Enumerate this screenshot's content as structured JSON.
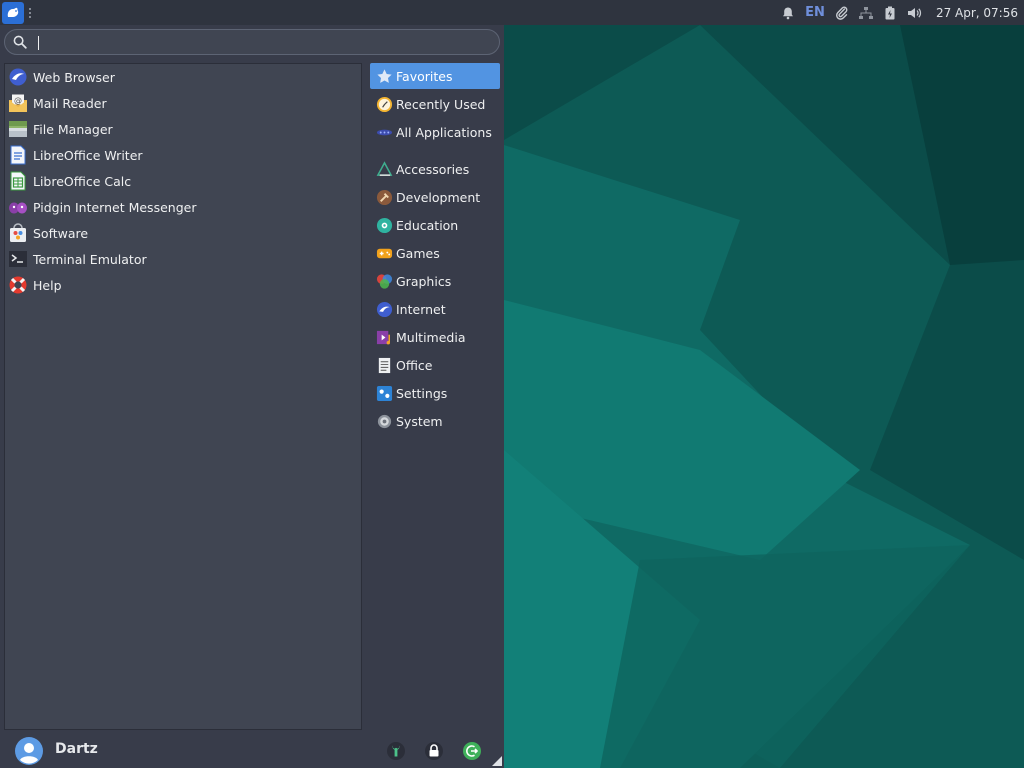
{
  "panel": {
    "keyboard_layout": "EN",
    "clock": "27 Apr, 07:56"
  },
  "search": {
    "value": "",
    "placeholder": ""
  },
  "favorites": [
    {
      "label": "Web Browser",
      "icon": "web-browser-icon"
    },
    {
      "label": "Mail Reader",
      "icon": "mail-reader-icon"
    },
    {
      "label": "File Manager",
      "icon": "file-manager-icon"
    },
    {
      "label": "LibreOffice Writer",
      "icon": "libreoffice-writer-icon"
    },
    {
      "label": "LibreOffice Calc",
      "icon": "libreoffice-calc-icon"
    },
    {
      "label": "Pidgin Internet Messenger",
      "icon": "pidgin-icon"
    },
    {
      "label": "Software",
      "icon": "software-icon"
    },
    {
      "label": "Terminal Emulator",
      "icon": "terminal-icon"
    },
    {
      "label": "Help",
      "icon": "help-icon"
    }
  ],
  "categories": [
    {
      "label": "Favorites",
      "icon": "star-icon",
      "active": true
    },
    {
      "label": "Recently Used",
      "icon": "clock-icon"
    },
    {
      "label": "All Applications",
      "icon": "all-applications-icon"
    },
    {
      "label": "Accessories",
      "icon": "accessories-icon"
    },
    {
      "label": "Development",
      "icon": "development-icon"
    },
    {
      "label": "Education",
      "icon": "education-icon"
    },
    {
      "label": "Games",
      "icon": "games-icon"
    },
    {
      "label": "Graphics",
      "icon": "graphics-icon"
    },
    {
      "label": "Internet",
      "icon": "internet-icon"
    },
    {
      "label": "Multimedia",
      "icon": "multimedia-icon"
    },
    {
      "label": "Office",
      "icon": "office-icon"
    },
    {
      "label": "Settings",
      "icon": "settings-icon"
    },
    {
      "label": "System",
      "icon": "system-icon"
    }
  ],
  "user": {
    "name": "Dartz"
  },
  "colors": {
    "panel": "#2f343f",
    "menu": "#383c4a",
    "accent": "#5294e2",
    "desktop": "#0b4b48"
  }
}
